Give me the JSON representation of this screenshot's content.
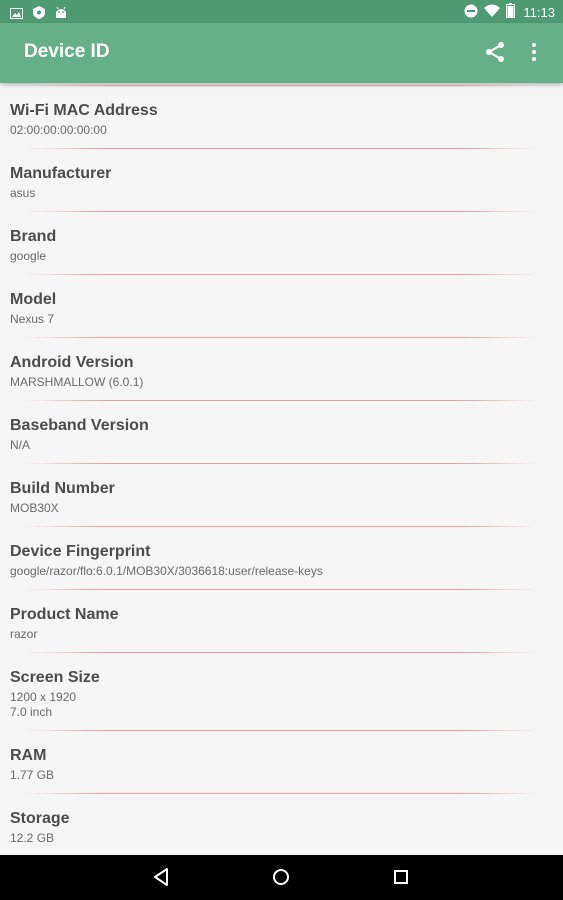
{
  "status_bar": {
    "time": "11:13",
    "left_icons": [
      "image-icon",
      "android-shield-icon",
      "android-icon"
    ],
    "right_icons": [
      "do-not-disturb-icon",
      "wifi-icon",
      "battery-icon"
    ]
  },
  "app_bar": {
    "title": "Device ID",
    "actions": [
      "share-icon",
      "more-vert-icon"
    ]
  },
  "items": [
    {
      "label": "Wi-Fi MAC Address",
      "value": "02:00:00:00:00:00"
    },
    {
      "label": "Manufacturer",
      "value": "asus"
    },
    {
      "label": "Brand",
      "value": "google"
    },
    {
      "label": "Model",
      "value": "Nexus 7"
    },
    {
      "label": "Android Version",
      "value": "MARSHMALLOW (6.0.1)"
    },
    {
      "label": "Baseband Version",
      "value": "N/A"
    },
    {
      "label": "Build Number",
      "value": "MOB30X"
    },
    {
      "label": "Device Fingerprint",
      "value": "google/razor/flo:6.0.1/MOB30X/3036618:user/release-keys"
    },
    {
      "label": "Product Name",
      "value": "razor"
    },
    {
      "label": "Screen Size",
      "value": "1200 x 1920\n7.0 inch"
    },
    {
      "label": "RAM",
      "value": "1.77 GB"
    },
    {
      "label": "Storage",
      "value": "12.2 GB"
    }
  ],
  "colors": {
    "status_bar": "#4e9a73",
    "app_bar": "#65b088",
    "divider": "#e68c8c",
    "background": "#f6f6f6"
  },
  "nav_bar": [
    "back-icon",
    "home-icon",
    "recents-icon"
  ]
}
